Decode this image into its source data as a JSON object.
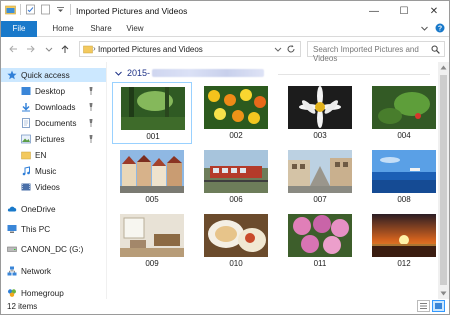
{
  "window": {
    "title": "Imported Pictures and Videos",
    "controls": {
      "minimize": "—",
      "maximize": "☐",
      "close": "✕"
    }
  },
  "ribbon": {
    "tabs": [
      {
        "label": "File"
      },
      {
        "label": "Home"
      },
      {
        "label": "Share"
      },
      {
        "label": "View"
      }
    ]
  },
  "address_bar": {
    "path_separator": "›",
    "path": "Imported Pictures and Videos"
  },
  "search": {
    "placeholder": "Search Imported Pictures and Videos"
  },
  "sidebar": {
    "items": [
      {
        "label": "Quick access",
        "icon": "star-icon",
        "pinned": false
      },
      {
        "label": "Desktop",
        "icon": "desktop-icon",
        "pinned": true
      },
      {
        "label": "Downloads",
        "icon": "download-icon",
        "pinned": true
      },
      {
        "label": "Documents",
        "icon": "documents-icon",
        "pinned": true
      },
      {
        "label": "Pictures",
        "icon": "pictures-icon",
        "pinned": true
      },
      {
        "label": "EN",
        "icon": "folder-icon",
        "pinned": false
      },
      {
        "label": "Music",
        "icon": "music-icon",
        "pinned": false
      },
      {
        "label": "Videos",
        "icon": "videos-icon",
        "pinned": false
      },
      {
        "label": "OneDrive",
        "icon": "cloud-icon",
        "pinned": false
      },
      {
        "label": "This PC",
        "icon": "computer-icon",
        "pinned": false
      },
      {
        "label": "CANON_DC (G:)",
        "icon": "drive-icon",
        "pinned": false
      },
      {
        "label": "Network",
        "icon": "network-icon",
        "pinned": false
      },
      {
        "label": "Homegroup",
        "icon": "homegroup-icon",
        "pinned": false
      }
    ]
  },
  "content": {
    "group_header": "2015-",
    "files": [
      {
        "name": "001",
        "kind": "forest"
      },
      {
        "name": "002",
        "kind": "flowers"
      },
      {
        "name": "003",
        "kind": "daisy"
      },
      {
        "name": "004",
        "kind": "leaf"
      },
      {
        "name": "005",
        "kind": "town"
      },
      {
        "name": "006",
        "kind": "train"
      },
      {
        "name": "007",
        "kind": "street"
      },
      {
        "name": "008",
        "kind": "sea"
      },
      {
        "name": "009",
        "kind": "room"
      },
      {
        "name": "010",
        "kind": "food"
      },
      {
        "name": "011",
        "kind": "hydrangea"
      },
      {
        "name": "012",
        "kind": "sunset"
      }
    ]
  },
  "status": {
    "item_count": "12 items"
  },
  "colors": {
    "accent": "#1979ca",
    "selection": "#cce8ff",
    "group_header": "#1e3287"
  }
}
